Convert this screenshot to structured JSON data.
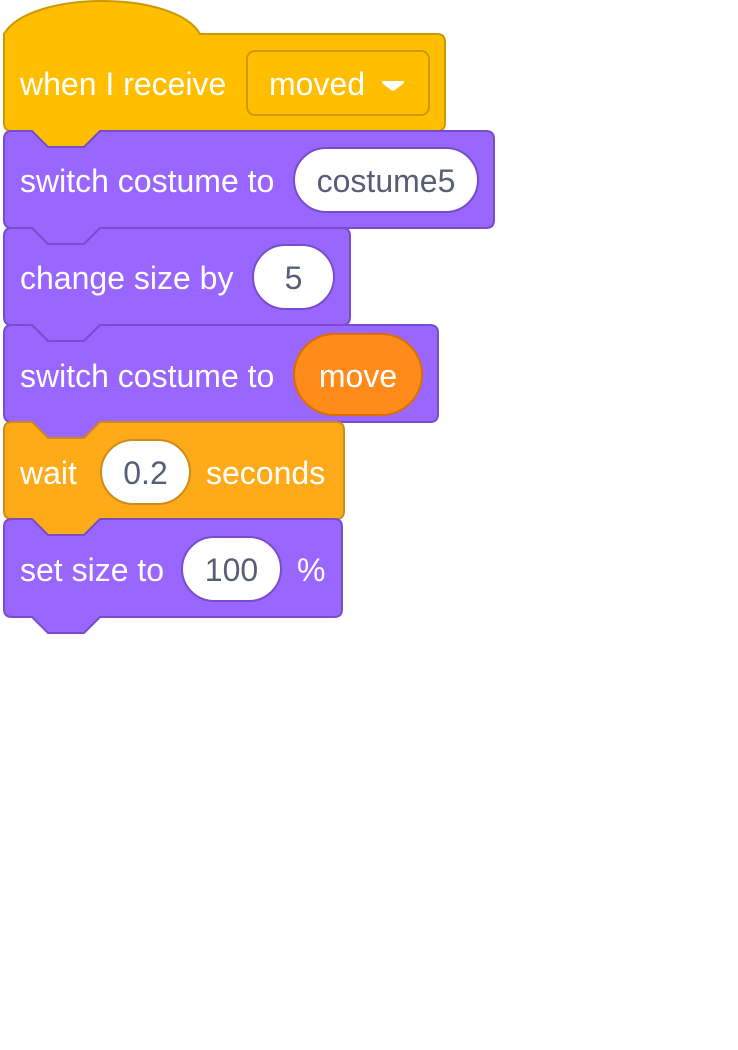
{
  "colors": {
    "events": "#ffbf00",
    "events_border": "#cc9900",
    "looks": "#9966ff",
    "looks_border": "#774dcb",
    "control": "#ffab19",
    "control_border": "#cf8b17",
    "reporter_orange": "#ff8c1a",
    "reporter_orange_border": "#db6e00",
    "field_text": "#575e75",
    "white": "#ffffff"
  },
  "script": {
    "hat": {
      "label": "when I receive",
      "message_dropdown": "moved",
      "dropdown_icon": "caret-down-icon"
    },
    "switch_costume_1": {
      "label": "switch costume to",
      "value": "costume5"
    },
    "change_size": {
      "label": "change size by",
      "value": "5"
    },
    "switch_costume_2": {
      "label": "switch costume to",
      "reporter": "move"
    },
    "wait": {
      "label": "wait",
      "value": "0.2",
      "suffix": "seconds"
    },
    "set_size": {
      "label": "set size to",
      "value": "100",
      "suffix": "%"
    }
  }
}
